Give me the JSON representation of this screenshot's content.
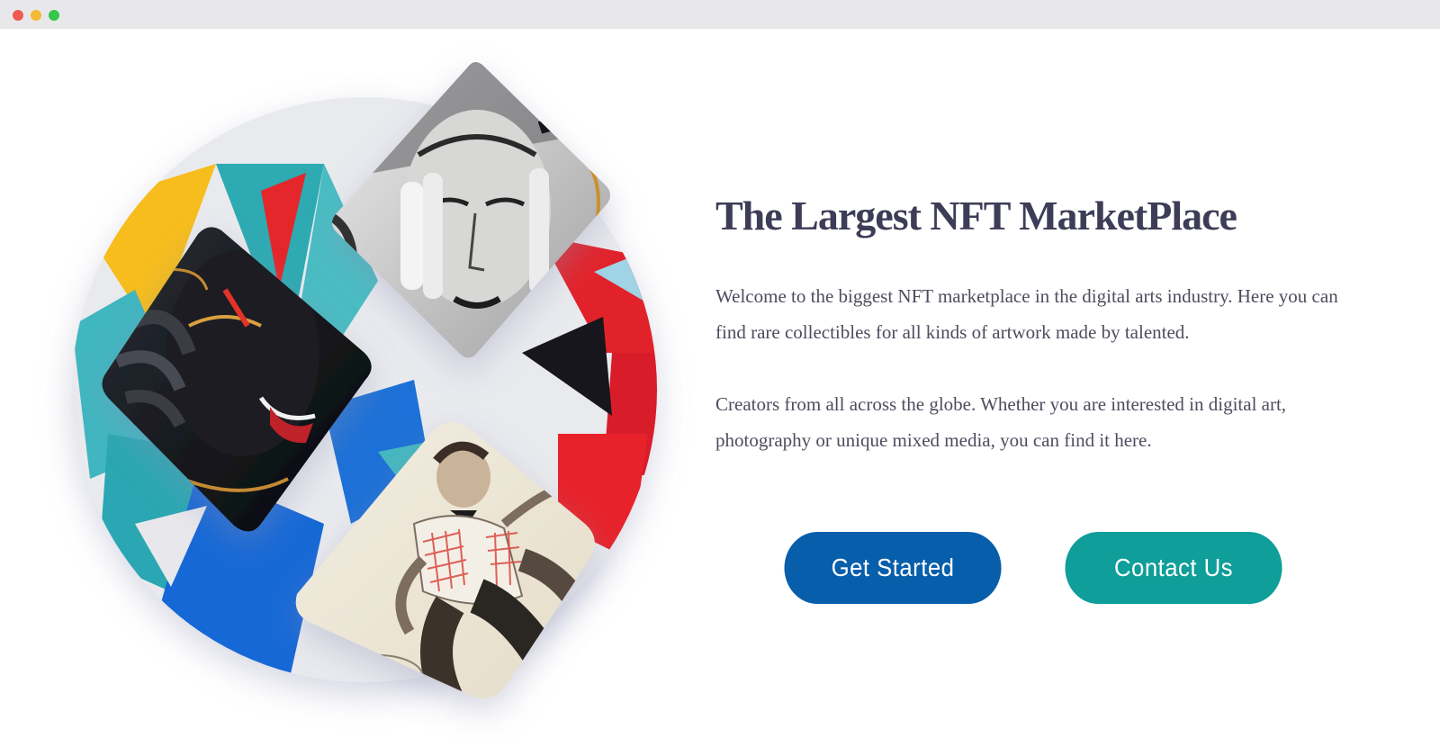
{
  "window": {
    "controls": [
      "close",
      "minimize",
      "maximize"
    ],
    "colors": {
      "close": "#ee5a52",
      "minimize": "#f4b935",
      "maximize": "#35c749"
    }
  },
  "hero": {
    "title": "The Largest NFT MarketPlace",
    "paragraph_1": "Welcome to the biggest NFT marketplace in the digital arts industry. Here you can find rare collectibles for all kinds of artwork made by talented.",
    "paragraph_2": "Creators from all across the globe. Whether you are interested in digital art, photography or unique mixed media, you can find it here.",
    "buttons": {
      "primary_label": "Get Started",
      "secondary_label": "Contact Us"
    }
  },
  "colors": {
    "title": "#3d3d57",
    "text": "#4d4d5f",
    "primary_button": "#075eab",
    "secondary_button": "#0f9e99"
  },
  "artwork": {
    "items": [
      "geometric-mural-art",
      "street-art-face-art",
      "painted-black-face-art",
      "illustrated-dancer-art"
    ]
  }
}
